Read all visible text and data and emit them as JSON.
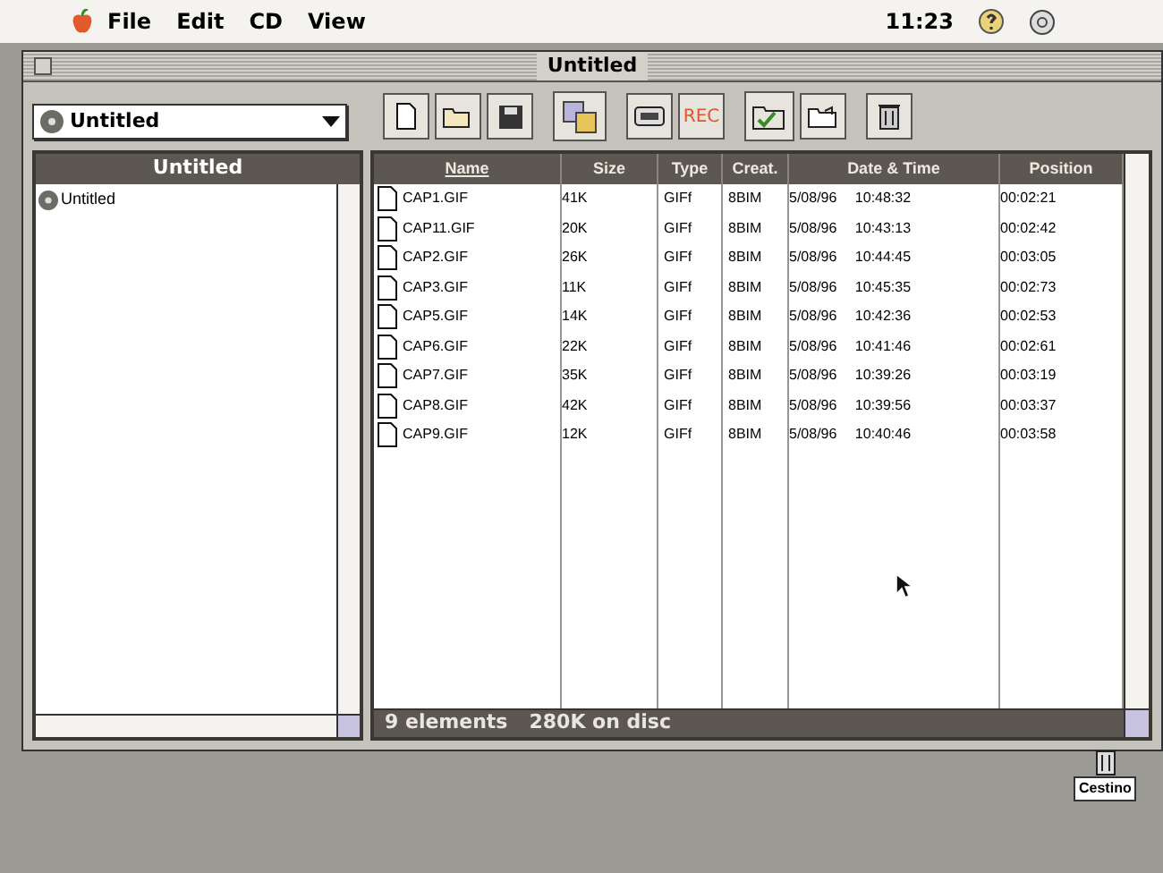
{
  "menu_bar": {
    "items": [
      "File",
      "Edit",
      "CD",
      "View"
    ],
    "clock": "11:23"
  },
  "window": {
    "title": "Untitled"
  },
  "volume_popup": {
    "value": "Untitled"
  },
  "toolbar": {
    "record_label": "REC"
  },
  "sidebar": {
    "title": "Untitled",
    "items": [
      {
        "label": "Untitled"
      }
    ]
  },
  "table": {
    "columns": [
      {
        "label": "Name",
        "selected": true
      },
      {
        "label": "Size",
        "selected": false
      },
      {
        "label": "Type",
        "selected": false
      },
      {
        "label": "Creat.",
        "selected": false
      },
      {
        "label": "Date & Time",
        "selected": false
      },
      {
        "label": "Position",
        "selected": false
      }
    ],
    "rows": [
      {
        "name": "CAP1.GIF",
        "size": "41K",
        "type": "GIFf",
        "creator": "8BIM",
        "date_time": "5/08/96 10:48:32",
        "position": "00:02:21"
      },
      {
        "name": "CAP11.GIF",
        "size": "20K",
        "type": "GIFf",
        "creator": "8BIM",
        "date_time": "5/08/96 10:43:13",
        "position": "00:02:42"
      },
      {
        "name": "CAP2.GIF",
        "size": "26K",
        "type": "GIFf",
        "creator": "8BIM",
        "date_time": "5/08/96 10:44:45",
        "position": "00:03:05"
      },
      {
        "name": "CAP3.GIF",
        "size": "11K",
        "type": "GIFf",
        "creator": "8BIM",
        "date_time": "5/08/96 10:45:35",
        "position": "00:02:73"
      },
      {
        "name": "CAP5.GIF",
        "size": "14K",
        "type": "GIFf",
        "creator": "8BIM",
        "date_time": "5/08/96 10:42:36",
        "position": "00:02:53"
      },
      {
        "name": "CAP6.GIF",
        "size": "22K",
        "type": "GIFf",
        "creator": "8BIM",
        "date_time": "5/08/96 10:41:46",
        "position": "00:02:61"
      },
      {
        "name": "CAP7.GIF",
        "size": "35K",
        "type": "GIFf",
        "creator": "8BIM",
        "date_time": "5/08/96 10:39:26",
        "position": "00:03:19"
      },
      {
        "name": "CAP8.GIF",
        "size": "42K",
        "type": "GIFf",
        "creator": "8BIM",
        "date_time": "5/08/96 10:39:56",
        "position": "00:03:37"
      },
      {
        "name": "CAP9.GIF",
        "size": "12K",
        "type": "GIFf",
        "creator": "8BIM",
        "date_time": "5/08/96 10:40:46",
        "position": "00:03:58"
      }
    ]
  },
  "status_bar": {
    "count": "9 elements",
    "disk": "280K on disc"
  },
  "desktop": {
    "trash_label": "Cestino"
  }
}
